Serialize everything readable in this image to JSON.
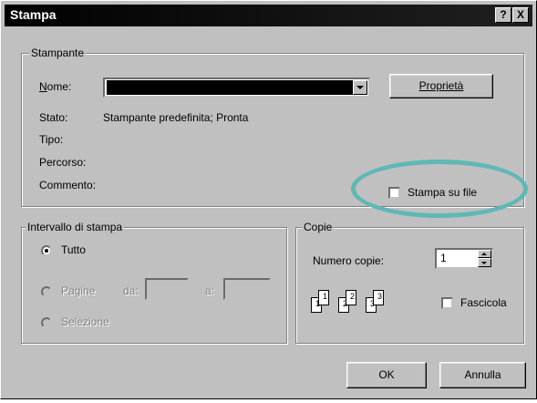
{
  "title": "Stampa",
  "titlebar": {
    "help": "?",
    "close": "X"
  },
  "printer": {
    "legend": "Stampante",
    "name_label": "Nome:",
    "name_value": "",
    "properties_button": "Proprietà",
    "status_label": "Stato:",
    "status_value": "Stampante predefinita; Pronta",
    "type_label": "Tipo:",
    "path_label": "Percorso:",
    "comment_label": "Commento:",
    "print_to_file_label": "Stampa su file",
    "print_to_file_checked": false
  },
  "range": {
    "legend": "Intervallo di stampa",
    "all_label": "Tutto",
    "pages_label": "Pagine",
    "from_label": "da:",
    "to_label": "a:",
    "selection_label": "Selezione",
    "selected": "all"
  },
  "copies": {
    "legend": "Copie",
    "count_label": "Numero copie:",
    "count_value": "1",
    "collate_label": "Fascicola",
    "collate_checked": false,
    "page_numbers": [
      "1",
      "1",
      "2",
      "2",
      "3",
      "3"
    ]
  },
  "buttons": {
    "ok": "OK",
    "cancel": "Annulla"
  },
  "colors": {
    "dialog_bg": "#c0c0c0",
    "highlight_ellipse": "#5fb8b4",
    "titlebar_bg": "#000000"
  }
}
